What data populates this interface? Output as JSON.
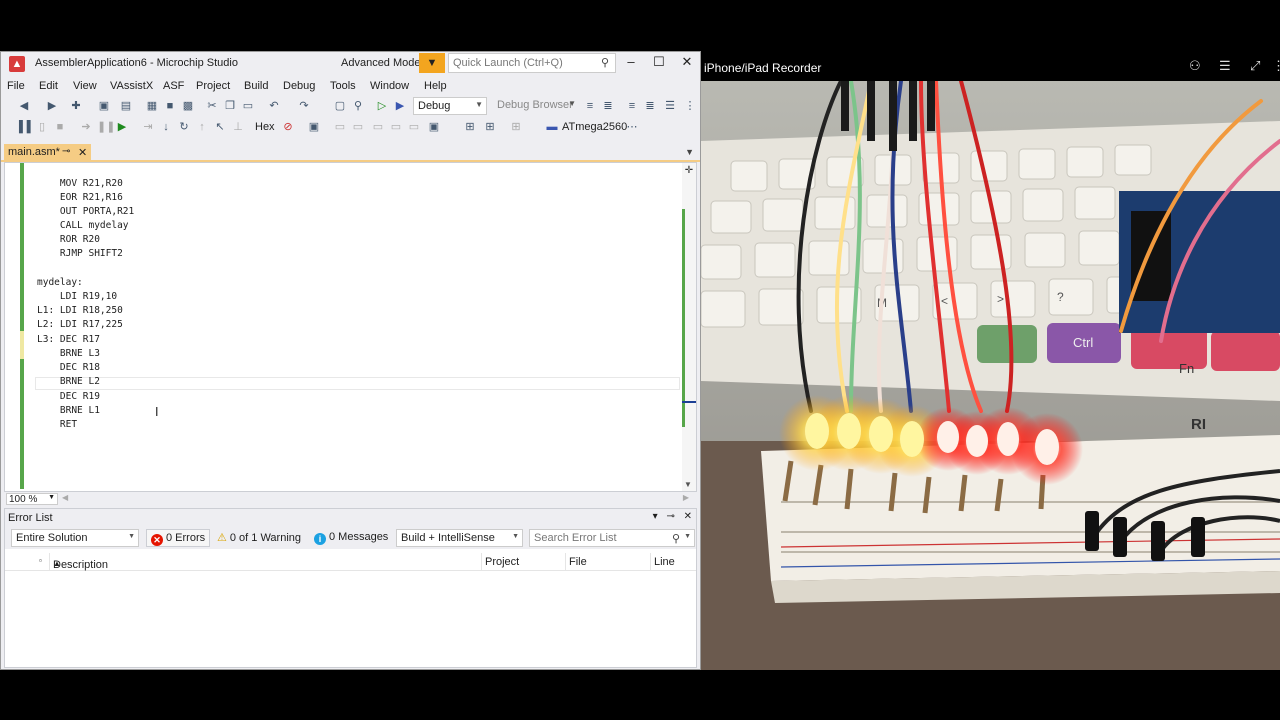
{
  "ide": {
    "title": "AssemblerApplication6 - Microchip Studio",
    "mode": "Advanced Mode",
    "quick_launch_placeholder": "Quick Launch (Ctrl+Q)",
    "menu": [
      "File",
      "Edit",
      "View",
      "VAssistX",
      "ASF",
      "Project",
      "Build",
      "Debug",
      "Tools",
      "Window",
      "Help"
    ],
    "toolbar": {
      "config": "Debug",
      "debug_browser": "Debug Browser",
      "hex": "Hex",
      "device": "ATmega2560"
    },
    "tab": {
      "label": "main.asm*"
    },
    "code": [
      "    MOV R21,R20",
      "    EOR R21,R16",
      "    OUT PORTA,R21",
      "    CALL mydelay",
      "    ROR R20",
      "    RJMP SHIFT2",
      "",
      "mydelay:",
      "    LDI R19,10",
      "L1: LDI R18,250",
      "L2: LDI R17,225",
      "L3: DEC R17",
      "    BRNE L3",
      "    DEC R18",
      "    BRNE L2",
      "    DEC R19",
      "    BRNE L1",
      "    RET"
    ],
    "zoom": "100 %"
  },
  "error_list": {
    "title": "Error List",
    "scope": "Entire Solution",
    "errors": "0 Errors",
    "warnings": "0 of 1 Warning",
    "messages": "0 Messages",
    "source": "Build + IntelliSense",
    "search_placeholder": "Search Error List",
    "columns": [
      "Description",
      "Project",
      "File",
      "Line"
    ]
  },
  "recorder": {
    "title": "iPhone/iPad Recorder",
    "keys": [
      "M",
      "<",
      ">",
      "?",
      "Ctrl",
      "Fn"
    ],
    "brand_text": "RI",
    "colors": {
      "led_yellow": "#fff6a0",
      "led_red": "#ff3030",
      "board": "#f2eee6",
      "desk": "#6b5a4e"
    }
  }
}
